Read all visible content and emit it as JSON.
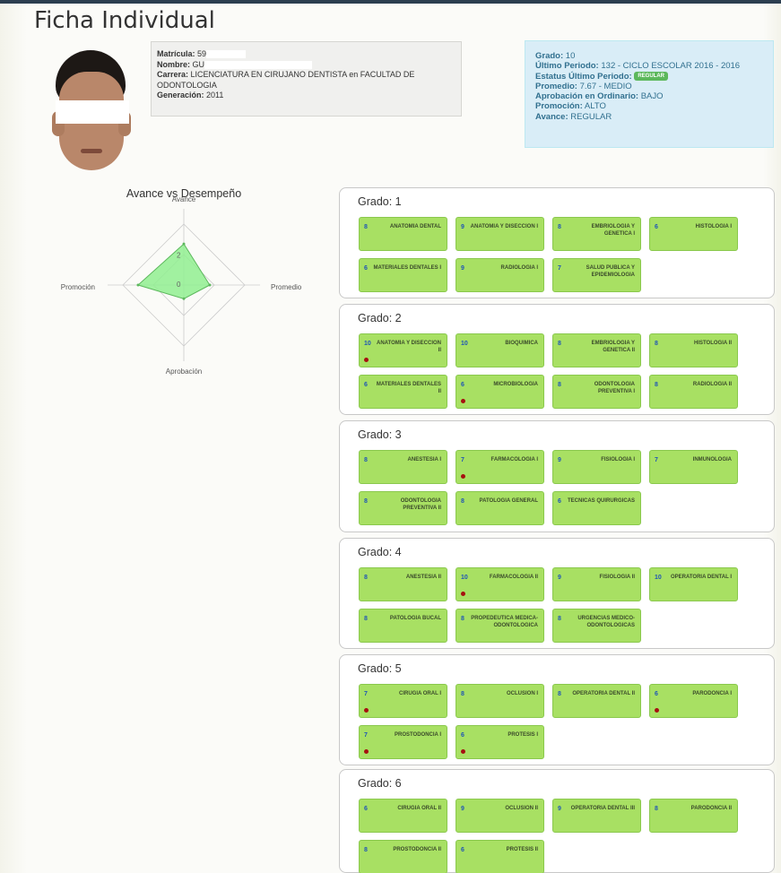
{
  "page": {
    "title": "Ficha Individual"
  },
  "student": {
    "matricula_label": "Matrícula:",
    "matricula_value": "59",
    "nombre_label": "Nombre:",
    "nombre_value": "GU",
    "carrera_label": "Carrera:",
    "carrera_value": "LICENCIATURA EN CIRUJANO DENTISTA en FACULTAD DE ODONTOLOGIA",
    "generacion_label": "Generación:",
    "generacion_value": "2011"
  },
  "status": {
    "grado_label": "Grado:",
    "grado_value": "10",
    "ultimo_periodo_label": "Último Periodo:",
    "ultimo_periodo_value": "132 - CICLO ESCOLAR 2016 - 2016",
    "estatus_label": "Estatus Último Periodo:",
    "estatus_badge": "REGULAR",
    "promedio_label": "Promedio:",
    "promedio_value": "7.67 - MEDIO",
    "aprobacion_label": "Aprobación en Ordinario:",
    "aprobacion_value": "BAJO",
    "promocion_label": "Promoción:",
    "promocion_value": "ALTO",
    "avance_label": "Avance:",
    "avance_value": "REGULAR",
    "badge_color": "#5cb85c",
    "box_color": "#d9edf7"
  },
  "chart_data": {
    "type": "radar",
    "title": "Avance vs Desempeño",
    "axes": [
      "Avance",
      "Promedio",
      "Aprobación",
      "Promoción"
    ],
    "values": [
      2.7,
      1.7,
      0.9,
      3.0
    ],
    "rlim": [
      0,
      5
    ],
    "tick_labels": [
      "2",
      "0"
    ],
    "fill_color": "#90ee90",
    "line_color": "#5cb85c"
  },
  "grades": [
    {
      "title": "Grado: 1",
      "courses": [
        {
          "score": "8",
          "name": "ANATOMIA DENTAL",
          "flag": false
        },
        {
          "score": "9",
          "name": "ANATOMIA Y DISECCION I",
          "flag": false
        },
        {
          "score": "8",
          "name": "EMBRIOLOGIA Y GENETICA I",
          "flag": false
        },
        {
          "score": "6",
          "name": "HISTOLOGIA I",
          "flag": false
        },
        {
          "score": "6",
          "name": "MATERIALES DENTALES I",
          "flag": false
        },
        {
          "score": "9",
          "name": "RADIOLOGIA I",
          "flag": false
        },
        {
          "score": "7",
          "name": "SALUD PUBLICA Y EPIDEMIOLOGIA",
          "flag": false
        }
      ]
    },
    {
      "title": "Grado: 2",
      "courses": [
        {
          "score": "10",
          "name": "ANATOMIA Y DISECCION II",
          "flag": true
        },
        {
          "score": "10",
          "name": "BIOQUIMICA",
          "flag": false
        },
        {
          "score": "8",
          "name": "EMBRIOLOGIA Y GENETICA II",
          "flag": false
        },
        {
          "score": "8",
          "name": "HISTOLOGIA II",
          "flag": false
        },
        {
          "score": "6",
          "name": "MATERIALES DENTALES II",
          "flag": false
        },
        {
          "score": "6",
          "name": "MICROBIOLOGIA",
          "flag": true
        },
        {
          "score": "8",
          "name": "ODONTOLOGIA PREVENTIVA I",
          "flag": false
        },
        {
          "score": "8",
          "name": "RADIOLOGIA II",
          "flag": false
        }
      ]
    },
    {
      "title": "Grado: 3",
      "courses": [
        {
          "score": "8",
          "name": "ANESTESIA I",
          "flag": false
        },
        {
          "score": "7",
          "name": "FARMACOLOGIA I",
          "flag": true
        },
        {
          "score": "9",
          "name": "FISIOLOGIA I",
          "flag": false
        },
        {
          "score": "7",
          "name": "INMUNOLOGIA",
          "flag": false
        },
        {
          "score": "8",
          "name": "ODONTOLOGIA PREVENTIVA II",
          "flag": false
        },
        {
          "score": "8",
          "name": "PATOLOGIA GENERAL",
          "flag": false
        },
        {
          "score": "6",
          "name": "TECNICAS QUIRURGICAS",
          "flag": false
        }
      ]
    },
    {
      "title": "Grado: 4",
      "courses": [
        {
          "score": "8",
          "name": "ANESTESIA II",
          "flag": false
        },
        {
          "score": "10",
          "name": "FARMACOLOGIA II",
          "flag": true
        },
        {
          "score": "9",
          "name": "FISIOLOGIA II",
          "flag": false
        },
        {
          "score": "10",
          "name": "OPERATORIA DENTAL I",
          "flag": false
        },
        {
          "score": "8",
          "name": "PATOLOGIA BUCAL",
          "flag": false
        },
        {
          "score": "8",
          "name": "PROPEDEUTICA MEDICA-ODONTOLOGICA",
          "flag": false
        },
        {
          "score": "8",
          "name": "URGENCIAS MEDICO-ODONTOLOGICAS",
          "flag": false
        }
      ]
    },
    {
      "title": "Grado: 5",
      "courses": [
        {
          "score": "7",
          "name": "CIRUGIA ORAL I",
          "flag": true
        },
        {
          "score": "8",
          "name": "OCLUSION I",
          "flag": false
        },
        {
          "score": "8",
          "name": "OPERATORIA DENTAL II",
          "flag": false
        },
        {
          "score": "6",
          "name": "PARODONCIA I",
          "flag": true
        },
        {
          "score": "7",
          "name": "PROSTODONCIA I",
          "flag": true
        },
        {
          "score": "6",
          "name": "PROTESIS I",
          "flag": true
        }
      ]
    },
    {
      "title": "Grado: 6",
      "courses": [
        {
          "score": "6",
          "name": "CIRUGIA ORAL II",
          "flag": false
        },
        {
          "score": "9",
          "name": "OCLUSION II",
          "flag": false
        },
        {
          "score": "9",
          "name": "OPERATORIA DENTAL III",
          "flag": false
        },
        {
          "score": "8",
          "name": "PARODONCIA II",
          "flag": false
        },
        {
          "score": "8",
          "name": "PROSTODONCIA II",
          "flag": false
        },
        {
          "score": "6",
          "name": "PROTESIS II",
          "flag": false
        }
      ]
    }
  ]
}
